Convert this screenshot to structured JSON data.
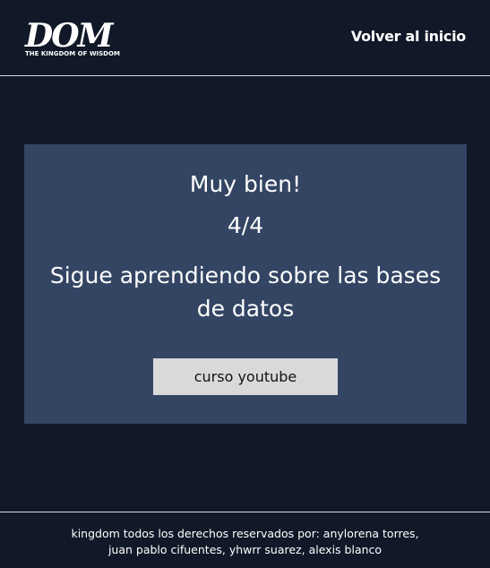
{
  "header": {
    "logo": {
      "mark": "DOM",
      "tagline": "THE KINGDOM OF WISDOM"
    },
    "home_link": "Volver al inicio"
  },
  "result_card": {
    "headline": "Muy bien!",
    "score": "4/4",
    "message": "Sigue aprendiendo sobre las bases de datos",
    "button_label": "curso youtube"
  },
  "footer": {
    "line1": "kingdom todos los derechos reservados por: anylorena torres,",
    "line2": "juan pablo cifuentes, yhwrr suarez, alexis blanco"
  },
  "colors": {
    "page_background": "#111827",
    "card_background": "#334563",
    "button_background": "#d9d9d9",
    "text": "#ffffff"
  }
}
